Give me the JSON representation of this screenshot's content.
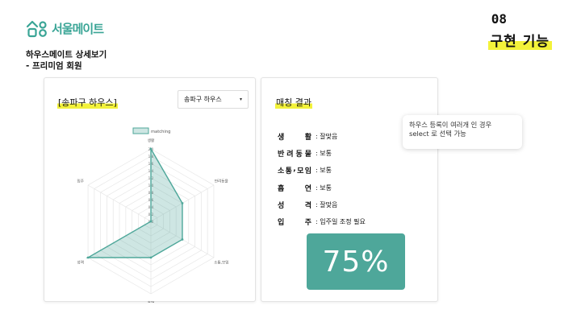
{
  "brand": {
    "name": "서울메이트",
    "color": "#3aa596",
    "icon": "house-person-logo-icon"
  },
  "section": {
    "number": "08",
    "title": "구현 기능",
    "highlight": "#f3f23a"
  },
  "subtitle": {
    "line1": "하우스메이트 상세보기",
    "line2": "- 프리미엄 회원"
  },
  "left_card": {
    "title": "[송파구 하우스]",
    "select": {
      "selected": "송파구 하우스",
      "arrow": "▾"
    }
  },
  "right_card": {
    "title": "매칭 결과",
    "attributes": [
      {
        "label": "생활",
        "value": ": 잘맞음"
      },
      {
        "label": "반려동물",
        "value": ": 보통"
      },
      {
        "label": "소통,모임",
        "value": ": 보통"
      },
      {
        "label": "흡연",
        "value": ": 보통"
      },
      {
        "label": "성격",
        "value": ": 잘맞음"
      },
      {
        "label": "입주",
        "value": ": 입주일 조정 필요"
      }
    ],
    "result": "75%"
  },
  "tooltip": {
    "line1": "하우스 등록이 여러개 인 경우",
    "line2": "select 로 선택 가능"
  },
  "chart_data": {
    "type": "radar",
    "title": "",
    "legend": "matching",
    "legend_position": "top",
    "categories": [
      "생활",
      "반려동물",
      "소통,모임",
      "흡연",
      "성격",
      "입주"
    ],
    "series": [
      {
        "name": "matching",
        "values": [
          2.0,
          1.0,
          1.0,
          1.0,
          2.0,
          0.0
        ]
      }
    ],
    "rlim": [
      0,
      2.0
    ],
    "ticks": [
      "0.0",
      "0.2",
      "0.4",
      "0.6",
      "0.8",
      "1.0",
      "1.2",
      "1.4",
      "1.6",
      "1.8",
      "2.0"
    ],
    "grid": true,
    "color": "#4ea79a"
  }
}
